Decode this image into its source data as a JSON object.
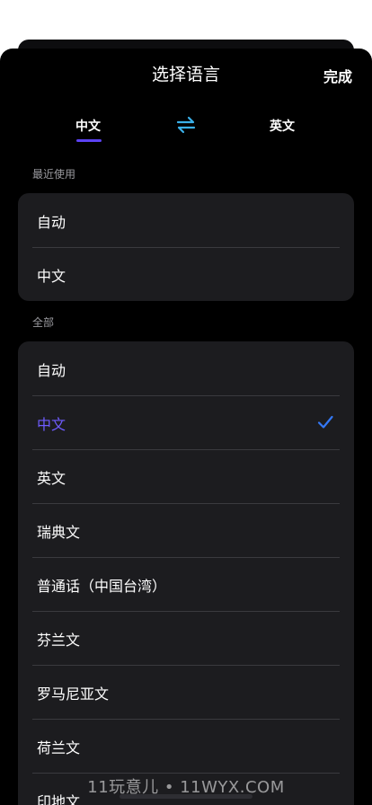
{
  "header": {
    "title": "选择语言",
    "done_label": "完成"
  },
  "language_switch": {
    "source": "中文",
    "target": "英文",
    "swap_icon": "swap-arrows-icon"
  },
  "sections": {
    "recent": {
      "label": "最近使用",
      "items": [
        "自动",
        "中文"
      ]
    },
    "all": {
      "label": "全部",
      "items": [
        "自动",
        "中文",
        "英文",
        "瑞典文",
        "普通话（中国台湾）",
        "芬兰文",
        "罗马尼亚文",
        "荷兰文",
        "印地文"
      ],
      "selected": "中文"
    }
  },
  "watermark": "11玩意儿 • 11WYX.COM",
  "colors": {
    "accent": "#5b42f3",
    "selected_text": "#6f5cff",
    "check": "#3478f6",
    "swap": "#3ab0e8"
  }
}
